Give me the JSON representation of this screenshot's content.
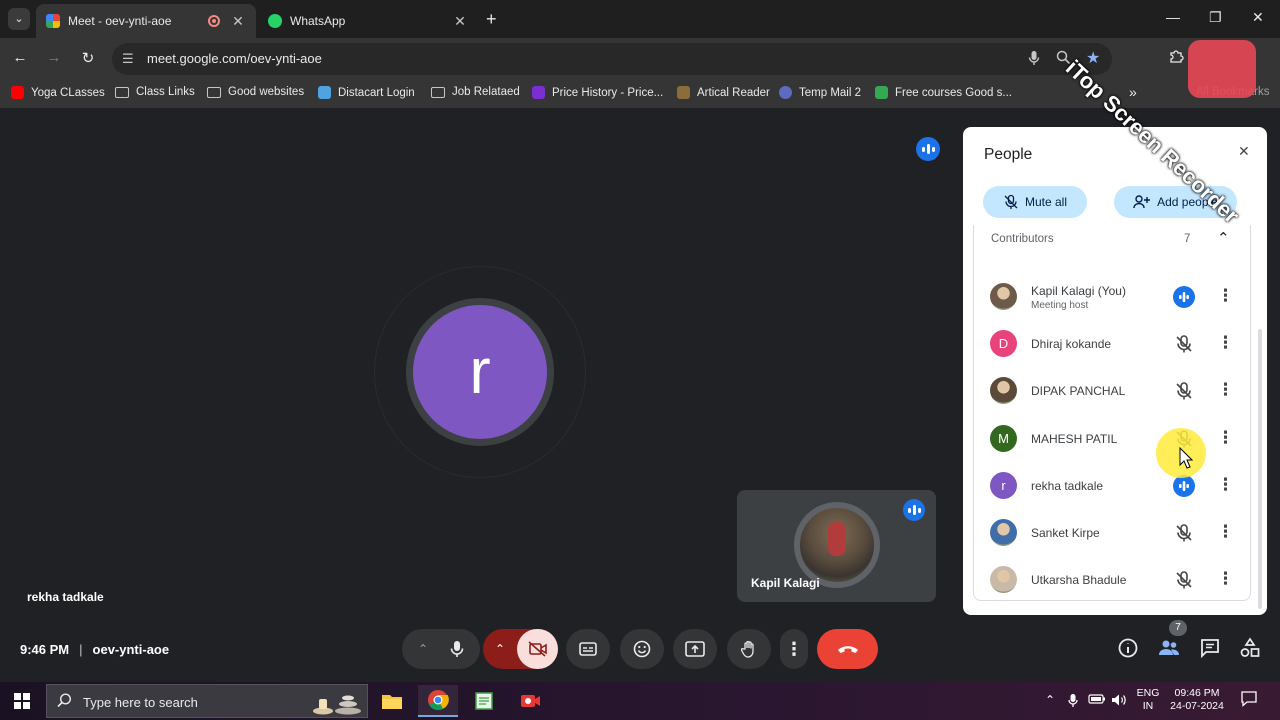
{
  "browser": {
    "tabs": [
      {
        "title": "Meet - oev-ynti-aoe",
        "active": true
      },
      {
        "title": "WhatsApp",
        "active": false
      }
    ],
    "new_tab_label": "+",
    "url": "meet.google.com/oev-ynti-aoe",
    "bookmarks": [
      {
        "label": "Yoga CLasses",
        "icon": "youtube-icon"
      },
      {
        "label": "Class Links",
        "icon": "folder-icon"
      },
      {
        "label": "Good websites",
        "icon": "folder-icon"
      },
      {
        "label": "Distacart Login",
        "icon": "site-icon"
      },
      {
        "label": "Job Relataed",
        "icon": "folder-icon"
      },
      {
        "label": "Price History - Price...",
        "icon": "site-icon"
      },
      {
        "label": "Artical Reader",
        "icon": "site-icon"
      },
      {
        "label": "Temp Mail 2",
        "icon": "site-icon"
      },
      {
        "label": "Free courses Good s...",
        "icon": "site-icon"
      }
    ],
    "overflow_label": "»",
    "all_bookmarks": "All Bookmarks"
  },
  "meeting": {
    "active_speaker": {
      "name": "rekha tadkale",
      "initial": "r",
      "color": "#7e57c2"
    },
    "self_tile_name": "Kapil Kalagi",
    "time": "9:46 PM",
    "separator": "|",
    "code": "oev-ynti-aoe",
    "participant_count": "7"
  },
  "people_panel": {
    "title": "People",
    "mute_all_label": "Mute all",
    "add_people_label": "Add people",
    "section_title": "Contributors",
    "section_count": "7",
    "participants": [
      {
        "name": "Kapil Kalagi (You)",
        "role": "Meeting host",
        "avatar": "photo",
        "color": "#6d5a4a",
        "initial": "",
        "speaking": true
      },
      {
        "name": "Dhiraj kokande",
        "role": "",
        "avatar": "initial",
        "color": "#e8437a",
        "initial": "D",
        "speaking": false
      },
      {
        "name": "DIPAK PANCHAL",
        "role": "",
        "avatar": "photo",
        "color": "#5b4a3a",
        "initial": "",
        "speaking": false
      },
      {
        "name": "MAHESH PATIL",
        "role": "",
        "avatar": "initial",
        "color": "#33691e",
        "initial": "M",
        "speaking": false
      },
      {
        "name": "rekha tadkale",
        "role": "",
        "avatar": "initial",
        "color": "#7e57c2",
        "initial": "r",
        "speaking": true
      },
      {
        "name": "Sanket Kirpe",
        "role": "",
        "avatar": "photo",
        "color": "#3f6ea8",
        "initial": "",
        "speaking": false
      },
      {
        "name": "Utkarsha Bhadule",
        "role": "",
        "avatar": "photo",
        "color": "#c9b9a8",
        "initial": "",
        "speaking": false
      }
    ]
  },
  "taskbar": {
    "search_placeholder": "Type here to search",
    "lang_top": "ENG",
    "lang_bottom": "IN",
    "clock_time": "09:46 PM",
    "clock_date": "24-07-2024"
  },
  "watermark": "iTop Screen Recorder",
  "colors": {
    "speaking_blue": "#1a73e8",
    "end_call_red": "#ea4335",
    "camera_off_red": "#8c1d18",
    "pill_blue": "#c2e7ff"
  }
}
